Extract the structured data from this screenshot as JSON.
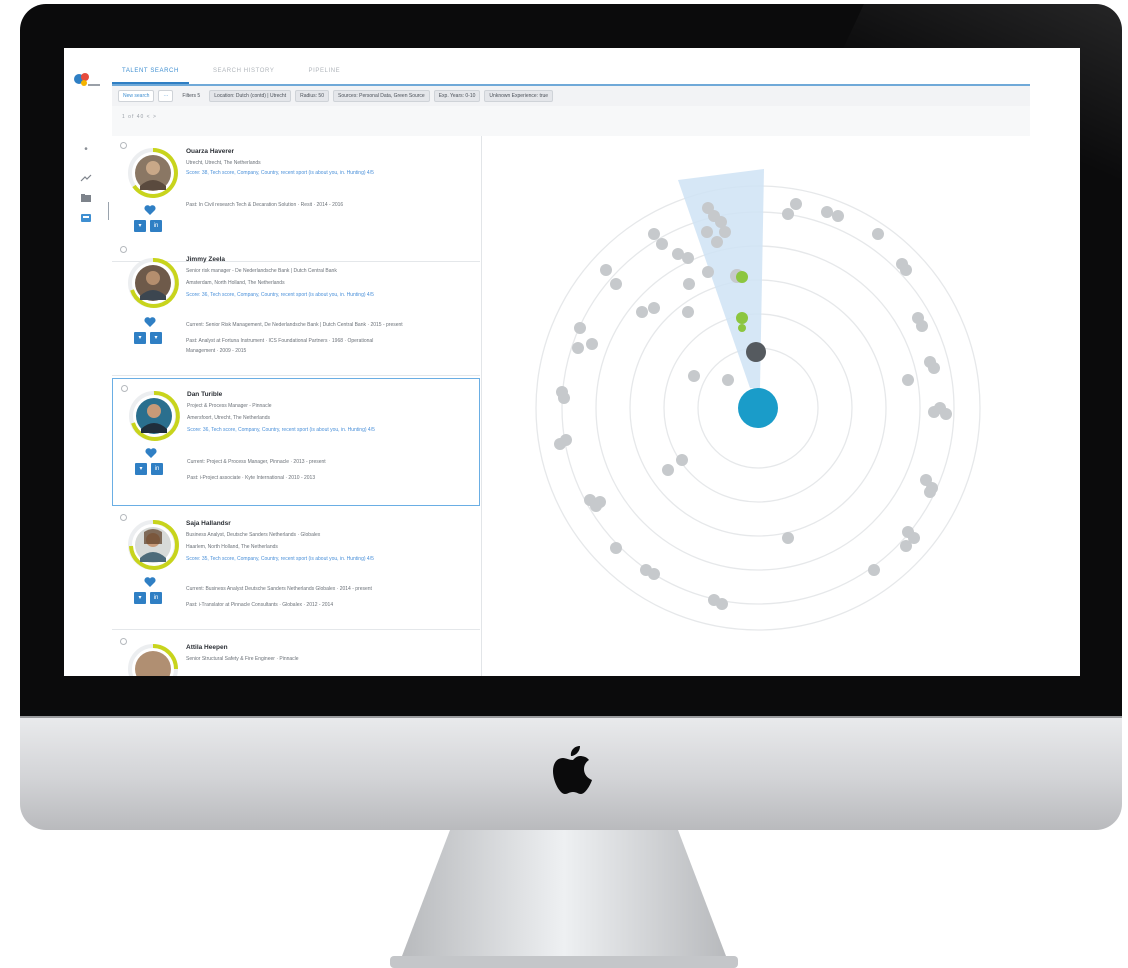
{
  "app": {
    "tabs": [
      {
        "label": "TALENT SEARCH",
        "active": true
      },
      {
        "label": "SEARCH HISTORY",
        "active": false
      },
      {
        "label": "PIPELINE",
        "active": false
      }
    ],
    "filters": {
      "new_search": "New search",
      "more": "···",
      "filters_label": "Filters",
      "filters_count": "5",
      "chips": [
        "Location: Dutch (contd) | Utrecht",
        "Radius: 50",
        "Sources: Personal Data, Green Source",
        "Exp. Years: 0-10",
        "Unknown Experience: true"
      ]
    },
    "pager": "1 of 40  <  >",
    "accent": "#2f7fc4",
    "ring_color": "#c8d41c"
  },
  "candidates": [
    {
      "name": "Ouarza Haverer",
      "lines": [
        {
          "text": "Utrecht, Utrecht, The Netherlands",
          "style": "grey"
        },
        {
          "text": "Score: 38, Tech score, Company, Country, recent sport (is about you, in. Hunting) 4/5",
          "style": "blue"
        },
        {
          "text": "",
          "style": "grey"
        },
        {
          "text": "Past: In Civil research Tech & Decaration Solution · Resit · 2014 - 2016",
          "style": "grey"
        }
      ]
    },
    {
      "name": "Jimmy Zeela",
      "lines": [
        {
          "text": "Senior risk manager - De Nederlandsche Bank | Dutch Central Bank",
          "style": "grey"
        },
        {
          "text": "Amsterdam, North Holland, The Netherlands",
          "style": "grey"
        },
        {
          "text": "Score: 36, Tech score, Company, Country, recent sport (is about you, in. Hunting) 4/5",
          "style": "blue"
        },
        {
          "text": "Current: Senior Risk Management, De Nederlandsche Bank | Dutch Central Bank · 2015 - present",
          "style": "grey"
        },
        {
          "text": "Past: Analyst at Fortuna Instrument · ICS Foundational Partners · 1968 · Operational",
          "style": "grey"
        },
        {
          "text": "Management · 2009 - 2015",
          "style": "grey"
        }
      ]
    },
    {
      "name": "Dan Turible",
      "lines": [
        {
          "text": "Project & Process Manager - Pinnacle",
          "style": "grey"
        },
        {
          "text": "Amersfoort, Utrecht, The Netherlands",
          "style": "grey"
        },
        {
          "text": "Score: 36, Tech score, Company, Country, recent sport (is about you, in. Hunting) 4/5",
          "style": "blue"
        },
        {
          "text": "Current: Project & Process Manager, Pinnacle · 2013 - present",
          "style": "grey"
        },
        {
          "text": "Past: i-Project associate · Kyte International · 2010 - 2013",
          "style": "grey"
        }
      ]
    },
    {
      "name": "Saja Hallandsr",
      "lines": [
        {
          "text": "Business Analyst, Deutsche Sanders Netherlands · Globalex",
          "style": "grey"
        },
        {
          "text": "Haarlem, North Holland, The Netherlands",
          "style": "grey"
        },
        {
          "text": "Score: 35, Tech score, Company, Country, recent sport (is about you, in. Hunting) 4/5",
          "style": "blue"
        },
        {
          "text": "Current: Business Analyst Deutsche Sanders Netherlands Globalex · 2014 - present",
          "style": "grey"
        },
        {
          "text": "Past: i-Translator at Pinnacle Consultants · Globalex · 2012 - 2014",
          "style": "grey"
        }
      ]
    },
    {
      "name": "Attila Heepen",
      "lines": [
        {
          "text": "Senior Structural Safety & Fire Engineer · Pinnacle",
          "style": "grey"
        }
      ]
    }
  ],
  "radar": {
    "center_color": "#1a9cc9",
    "rings": 6,
    "highlight_points": 3,
    "grey_points": 58
  }
}
